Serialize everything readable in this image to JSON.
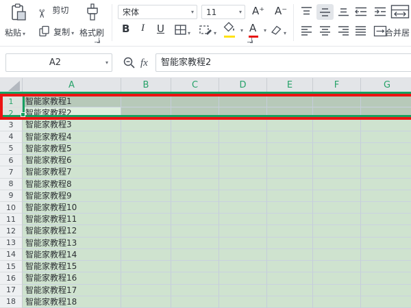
{
  "toolbar": {
    "paste": "粘贴",
    "cut": "剪切",
    "copy": "复制",
    "format_painter": "格式刷",
    "font_name": "宋体",
    "font_size": "11",
    "bold": "B",
    "italic": "I",
    "underline": "U",
    "grow_font": "A⁺",
    "shrink_font": "A⁻",
    "merge_center": "合并居"
  },
  "formula_bar": {
    "name_box_value": "A2",
    "fx_label": "fx",
    "formula_value": "智能家教程2"
  },
  "sheet": {
    "columns": [
      "A",
      "B",
      "C",
      "D",
      "E",
      "F",
      "G"
    ],
    "rows": [
      {
        "num": "1",
        "a": "智能家教程1"
      },
      {
        "num": "2",
        "a": "智能家教程2"
      },
      {
        "num": "3",
        "a": "智能家教程3"
      },
      {
        "num": "4",
        "a": "智能家教程4"
      },
      {
        "num": "5",
        "a": "智能家教程5"
      },
      {
        "num": "6",
        "a": "智能家教程6"
      },
      {
        "num": "7",
        "a": "智能家教程7"
      },
      {
        "num": "8",
        "a": "智能家教程8"
      },
      {
        "num": "9",
        "a": "智能家教程9"
      },
      {
        "num": "10",
        "a": "智能家教程10"
      },
      {
        "num": "11",
        "a": "智能家教程11"
      },
      {
        "num": "12",
        "a": "智能家教程12"
      },
      {
        "num": "13",
        "a": "智能家教程13"
      },
      {
        "num": "14",
        "a": "智能家教程14"
      },
      {
        "num": "15",
        "a": "智能家教程15"
      },
      {
        "num": "16",
        "a": "智能家教程16"
      },
      {
        "num": "17",
        "a": "智能家教程17"
      },
      {
        "num": "18",
        "a": "智能家教程18"
      }
    ]
  },
  "icons": {
    "paste-icon": "clipboard",
    "cut-icon": "scissors ✂",
    "copy-icon": "two-pages",
    "format-painter-icon": "brush",
    "borders-icon": "cell-borders-grid",
    "draw-border-icon": "grid-with-pencil",
    "fill-color-icon": "paint-bucket",
    "font-color-icon": "A-with-color-bar",
    "clear-icon": "eraser",
    "merge-center-icon": "merged-cell-arrows",
    "magnifier-icon": "magnifier-minus",
    "select-all-icon": "corner-triangle"
  },
  "colors": {
    "header_letter_green": "#26a269",
    "selection_border_teal": "#17a061",
    "annotation_red": "#ec1413",
    "cell_fill_green": "#cfe3cf",
    "selected_row_green": "#b7c9b9",
    "active_cell_green": "#ddeedd",
    "fill_swatch_yellow": "#ffe20f",
    "font_color_swatch_red": "#e8130c"
  }
}
